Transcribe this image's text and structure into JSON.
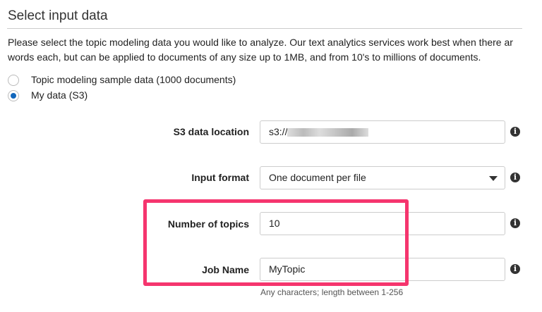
{
  "section_title": "Select input data",
  "description": [
    "Please select the topic modeling data you would like to analyze. Our text analytics services work best when there ar",
    "words each, but can be applied to documents of any size up to 1MB, and from 10's to millions of documents."
  ],
  "radios": [
    {
      "label": "Topic modeling sample data (1000 documents)",
      "selected": false
    },
    {
      "label": "My data (S3)",
      "selected": true
    }
  ],
  "fields": {
    "s3": {
      "label": "S3 data location",
      "value": "s3://"
    },
    "format": {
      "label": "Input format",
      "value": "One document per file"
    },
    "topics": {
      "label": "Number of topics",
      "value": "10"
    },
    "job": {
      "label": "Job Name",
      "value": "MyTopic",
      "help": "Any characters; length between 1-256"
    }
  },
  "info_glyph": "i",
  "highlight_color": "#f5356e"
}
